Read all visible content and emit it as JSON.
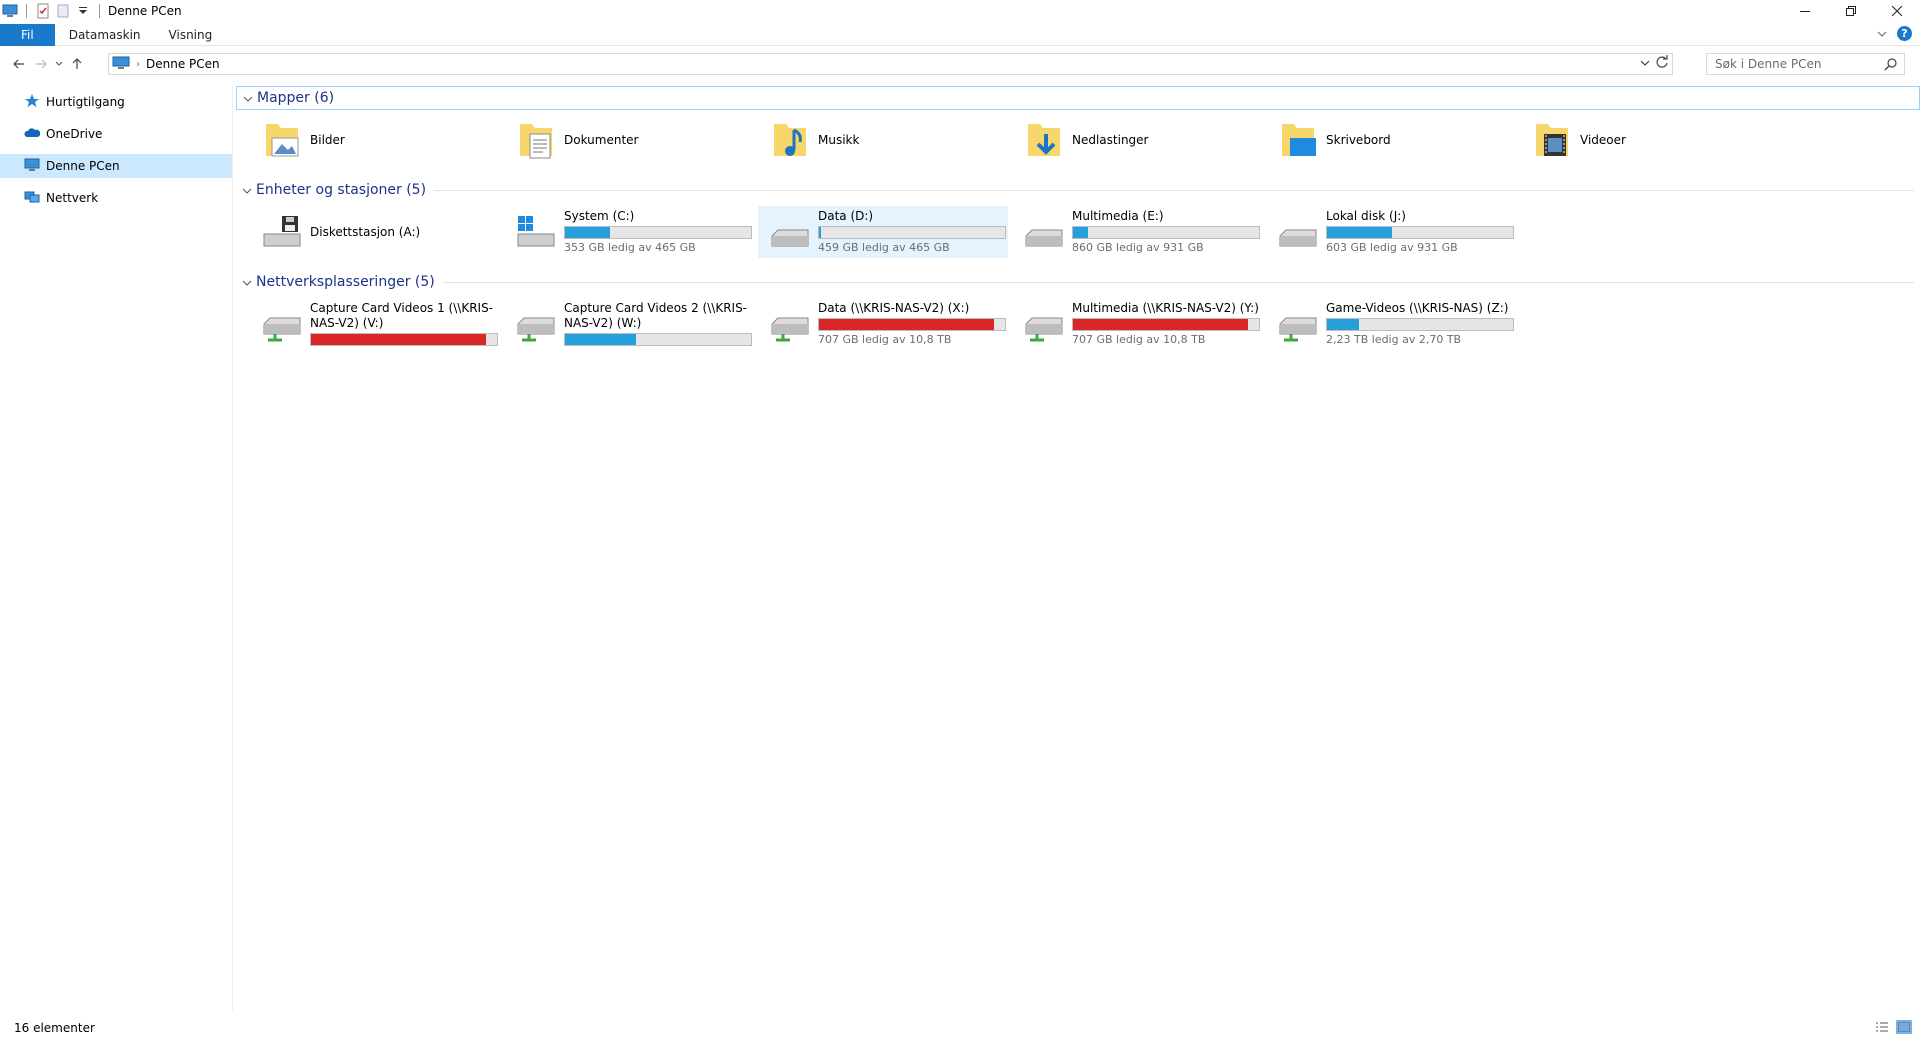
{
  "window": {
    "title": "Denne PCen",
    "controls": {
      "minimize": "—",
      "restore": "❐",
      "close": "✕"
    }
  },
  "ribbon": {
    "tabs": [
      "Fil",
      "Datamaskin",
      "Visning"
    ],
    "help": "?"
  },
  "address": {
    "path": "Denne PCen",
    "search_placeholder": "Søk i Denne PCen"
  },
  "sidebar": {
    "items": [
      {
        "label": "Hurtigtilgang",
        "icon": "star-icon",
        "selected": false
      },
      {
        "label": "OneDrive",
        "icon": "cloud-icon",
        "selected": false
      },
      {
        "label": "Denne PCen",
        "icon": "computer-icon",
        "selected": true
      },
      {
        "label": "Nettverk",
        "icon": "network-icon",
        "selected": false
      }
    ]
  },
  "groups": {
    "folders": {
      "title": "Mapper (6)",
      "items": [
        {
          "name": "Bilder",
          "icon": "pictures-folder-icon"
        },
        {
          "name": "Dokumenter",
          "icon": "documents-folder-icon"
        },
        {
          "name": "Musikk",
          "icon": "music-folder-icon"
        },
        {
          "name": "Nedlastinger",
          "icon": "downloads-folder-icon"
        },
        {
          "name": "Skrivebord",
          "icon": "desktop-folder-icon"
        },
        {
          "name": "Videoer",
          "icon": "videos-folder-icon"
        }
      ]
    },
    "devices": {
      "title": "Enheter og stasjoner (5)",
      "items": [
        {
          "name": "Diskettstasjon (A:)",
          "icon": "floppy-drive-icon"
        },
        {
          "name": "System (C:)",
          "icon": "windows-drive-icon",
          "free": "353 GB ledig av 465 GB",
          "used_fraction": 0.24,
          "bar": "blue"
        },
        {
          "name": "Data (D:)",
          "icon": "hard-drive-icon",
          "free": "459 GB ledig av 465 GB",
          "used_fraction": 0.01,
          "bar": "blue",
          "selected": true
        },
        {
          "name": "Multimedia (E:)",
          "icon": "hard-drive-icon",
          "free": "860 GB ledig av 931 GB",
          "used_fraction": 0.08,
          "bar": "blue"
        },
        {
          "name": "Lokal disk (J:)",
          "icon": "hard-drive-icon",
          "free": "603 GB ledig av 931 GB",
          "used_fraction": 0.35,
          "bar": "blue"
        }
      ]
    },
    "network": {
      "title": "Nettverksplasseringer (5)",
      "items": [
        {
          "name": "Capture Card Videos 1 (\\\\KRIS-NAS-V2) (V:)",
          "icon": "network-drive-icon",
          "used_fraction": 0.94,
          "bar": "red"
        },
        {
          "name": "Capture Card Videos 2 (\\\\KRIS-NAS-V2) (W:)",
          "icon": "network-drive-icon",
          "used_fraction": 0.38,
          "bar": "blue"
        },
        {
          "name": "Data (\\\\KRIS-NAS-V2) (X:)",
          "icon": "network-drive-icon",
          "free": "707 GB ledig av 10,8 TB",
          "used_fraction": 0.94,
          "bar": "red"
        },
        {
          "name": "Multimedia (\\\\KRIS-NAS-V2) (Y:)",
          "icon": "network-drive-icon",
          "free": "707 GB ledig av 10,8 TB",
          "used_fraction": 0.94,
          "bar": "red"
        },
        {
          "name": "Game-Videos (\\\\KRIS-NAS) (Z:)",
          "icon": "network-drive-icon",
          "free": "2,23 TB ledig av 2,70 TB",
          "used_fraction": 0.17,
          "bar": "blue"
        }
      ]
    }
  },
  "status": {
    "count": "16 elementer"
  },
  "colors": {
    "accent": "#1979ca",
    "group_header": "#1e3287",
    "bar_blue": "#26a0da",
    "bar_red": "#da2626",
    "selection": "#cce8ff"
  }
}
